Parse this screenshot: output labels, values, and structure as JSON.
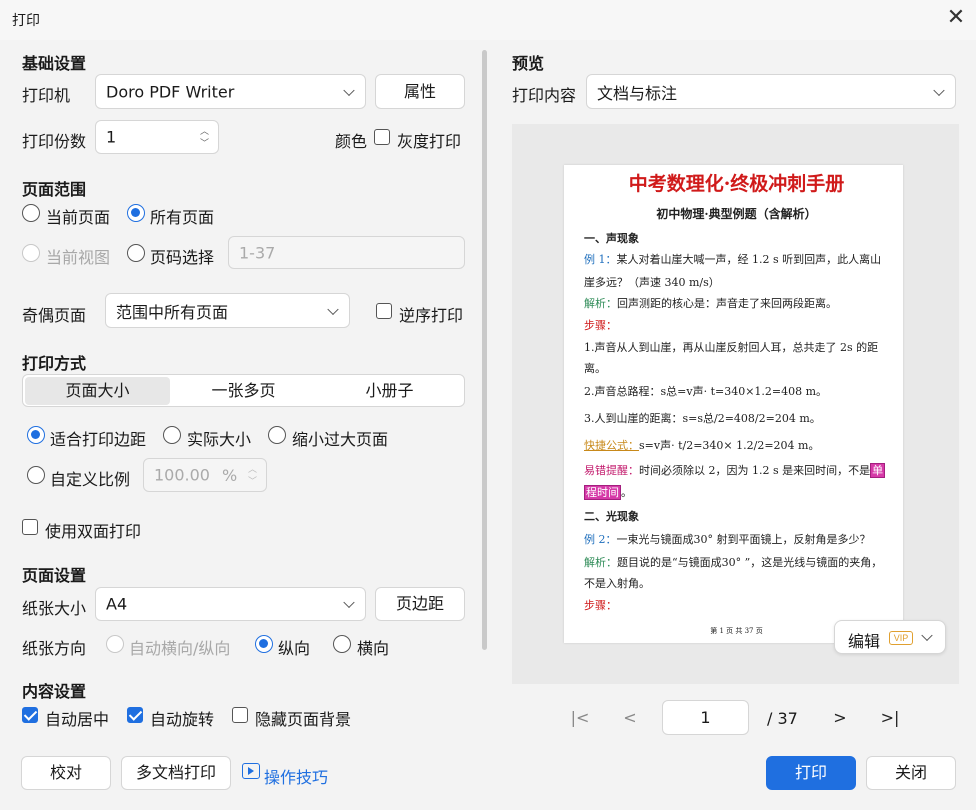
{
  "window": {
    "title": "打印",
    "close_glyph": "✕"
  },
  "basic": {
    "heading": "基础设置",
    "printer_label": "打印机",
    "printer_value": "Doro PDF Writer",
    "props_button": "属性",
    "copies_label": "打印份数",
    "copies_value": "1",
    "color_label": "颜色",
    "grayscale_label": "灰度打印"
  },
  "range": {
    "heading": "页面范围",
    "current_page": "当前页面",
    "all_pages": "所有页面",
    "current_view": "当前视图",
    "page_select": "页码选择",
    "page_select_placeholder": "1-37",
    "odd_even_label": "奇偶页面",
    "odd_even_value": "范围中所有页面",
    "reverse_label": "逆序打印"
  },
  "mode": {
    "heading": "打印方式",
    "tabs": [
      "页面大小",
      "一张多页",
      "小册子"
    ],
    "fit_margins": "适合打印边距",
    "actual_size": "实际大小",
    "shrink_large": "缩小过大页面",
    "custom_scale": "自定义比例",
    "scale_value": "100.00",
    "scale_unit": "%",
    "duplex_label": "使用双面打印"
  },
  "page_setup": {
    "heading": "页面设置",
    "paper_label": "纸张大小",
    "paper_value": "A4",
    "margins_button": "页边距",
    "orientation_label": "纸张方向",
    "auto_orient": "自动横向/纵向",
    "portrait": "纵向",
    "landscape": "横向"
  },
  "content": {
    "heading": "内容设置",
    "auto_center": "自动居中",
    "auto_rotate": "自动旋转",
    "hide_bg": "隐藏页面背景"
  },
  "footer": {
    "proof": "校对",
    "multi_doc": "多文档打印",
    "tips": "操作技巧",
    "print": "打印",
    "close": "关闭"
  },
  "preview": {
    "heading": "预览",
    "content_label": "打印内容",
    "content_value": "文档与标注",
    "edit_button": "编辑",
    "vip_badge": "VIP",
    "current_page": "1",
    "total_pages": "/ 37"
  },
  "doc": {
    "title": "中考数理化·终极冲刺手册",
    "subtitle": "初中物理·典型例题（含解析）",
    "s1": "一、声现象",
    "ex1_tag": "例 1：",
    "ex1_text": "某人对着山崖大喊一声，经 1.2 s 听到回声，此人离山",
    "ex1_text2": "崖多远？（声速 340 m/s）",
    "an1_tag": "解析：",
    "an1_text": "回声测距的核心是：声音走了来回两段距离。",
    "steps": "步骤：",
    "st1": "1.声音从人到山崖，再从山崖反射回人耳，总共走了 2s 的距",
    "st1b": "离。",
    "st2": "2.声音总路程：s总=v声· t=340×1.2=408 m。",
    "st3": "3.人到山崖的距离：s=s总/2=408/2=204 m。",
    "quick_tag": "快捷公式：",
    "quick_text": "s=v声· t/2=340× 1.2/2=204 m。",
    "err_tag": "易错提醒：",
    "err_text": "时间必须除以 2，因为 1.2 s 是来回时间，不是",
    "err_hl1": "单",
    "err_hl2": "程时间",
    "err_end": "。",
    "s2": "二、光现象",
    "ex2_tag": "例 2：",
    "ex2_text": "一束光与镜面成30° 射到平面镜上，反射角是多少？",
    "an2_tag": "解析：",
    "an2_text": "题目说的是“与镜面成30° ”，这是光线与镜面的夹角，",
    "an2_text2": "不是入射角。",
    "steps2": "步骤：",
    "footer": "第 1 页 共 37 页"
  }
}
